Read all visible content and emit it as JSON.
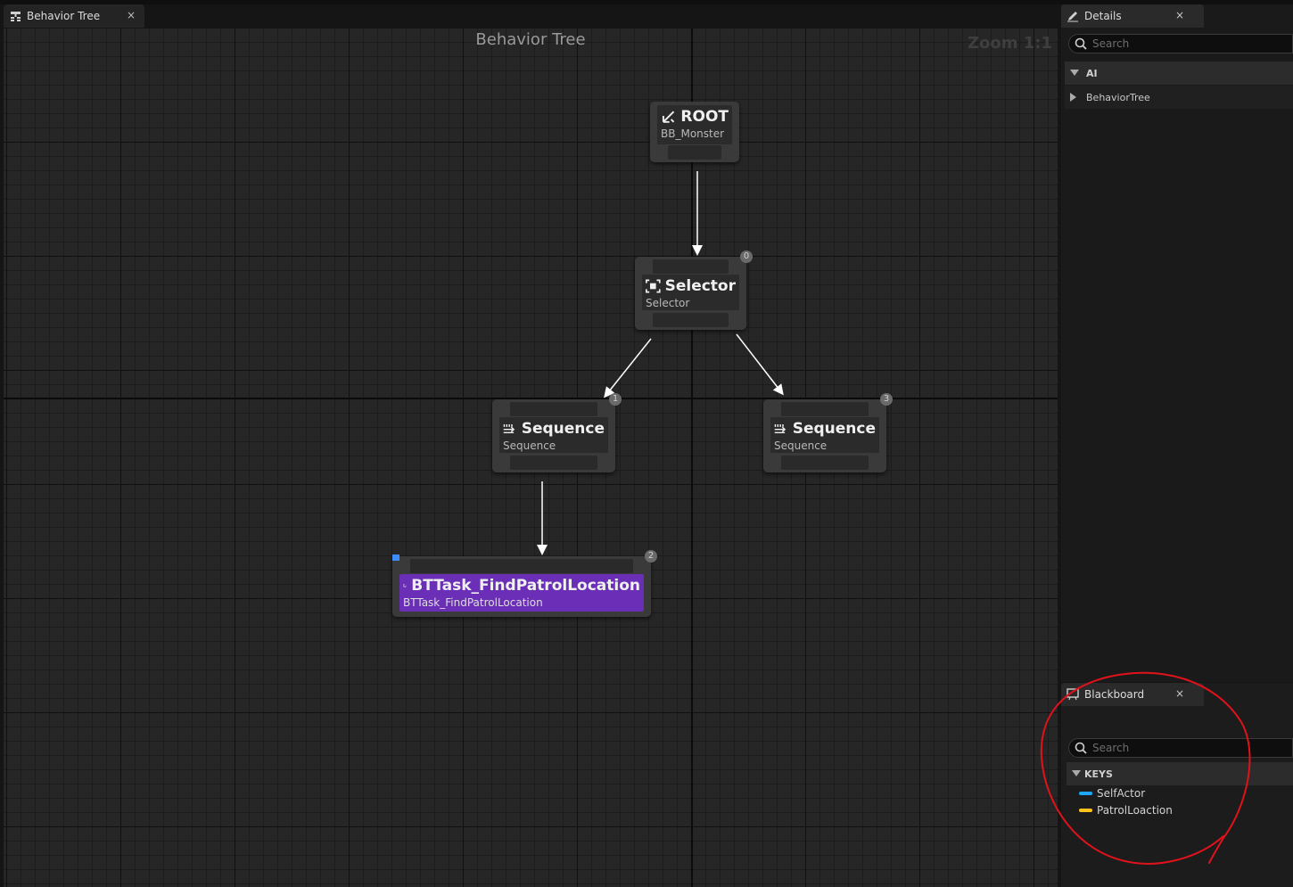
{
  "editor_tab": {
    "label": "Behavior Tree",
    "close": "×"
  },
  "graph": {
    "title": "Behavior Tree",
    "zoom": "Zoom 1:1",
    "nodes": {
      "root": {
        "title": "ROOT",
        "subtitle": "BB_Monster"
      },
      "selector": {
        "title": "Selector",
        "subtitle": "Selector",
        "index": "0"
      },
      "sequence_left": {
        "title": "Sequence",
        "subtitle": "Sequence",
        "index": "1"
      },
      "sequence_right": {
        "title": "Sequence",
        "subtitle": "Sequence",
        "index": "3"
      },
      "task": {
        "title": "BTTask_FindPatrolLocation",
        "subtitle": "BTTask_FindPatrolLocation",
        "index": "2"
      }
    }
  },
  "details": {
    "tab_label": "Details",
    "close": "×",
    "search_placeholder": "Search",
    "category": "AI",
    "item": "BehaviorTree"
  },
  "blackboard": {
    "tab_label": "Blackboard",
    "close": "×",
    "search_placeholder": "Search",
    "category": "KEYS",
    "keys": [
      {
        "name": "SelfActor",
        "color": "#1ea7ff"
      },
      {
        "name": "PatrolLoaction",
        "color": "#ffc21a"
      }
    ]
  },
  "colors": {
    "task_body": "#6a2fb6",
    "annotation": "#e0121b"
  }
}
